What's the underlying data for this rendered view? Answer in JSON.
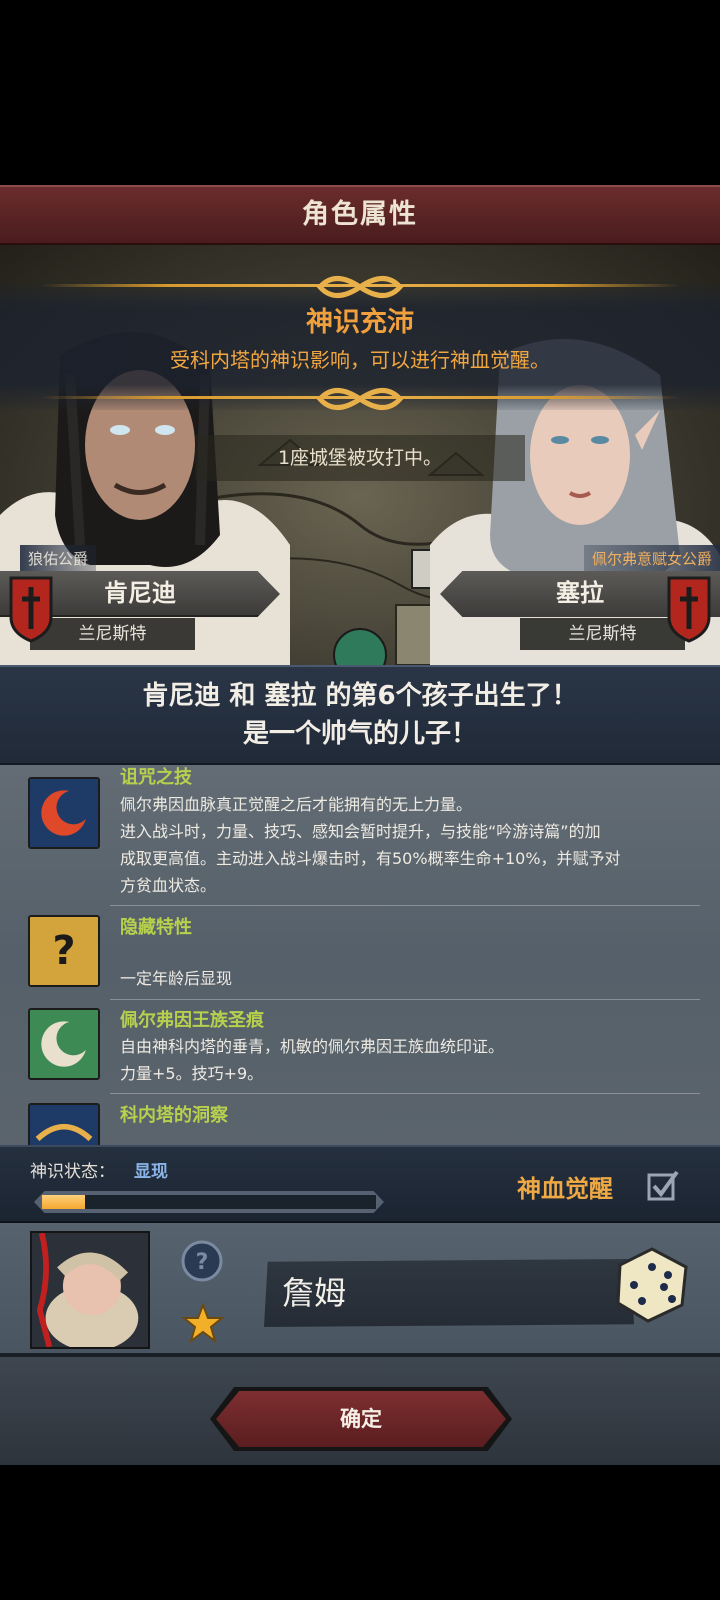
{
  "header": {
    "title": "角色属性"
  },
  "notice": {
    "title": "神识充沛",
    "text": "受科内塔的神识影响，可以进行神血觉醒。"
  },
  "map_status": {
    "text": "1座城堡被攻打中。"
  },
  "father": {
    "title": "狼佑公爵",
    "name": "肯尼迪",
    "house": "兰尼斯特"
  },
  "mother": {
    "title": "佩尔弗意赋女公爵",
    "name": "塞拉",
    "house": "兰尼斯特"
  },
  "announcement": {
    "line1": "肯尼迪 和 塞拉 的第6个孩子出生了！",
    "line2": "是一个帅气的儿子！"
  },
  "traits": [
    {
      "name": "诅咒之技",
      "icon": "red-crescent-icon",
      "lines": [
        "佩尔弗因血脉真正觉醒之后才能拥有的无上力量。",
        "进入战斗时，力量、技巧、感知会暂时提升，与技能“吟游诗篇”的加",
        "成取更高值。主动进入战斗爆击时，有50%概率生命+10%，并赋予对",
        "方贫血状态。"
      ]
    },
    {
      "name": "隐藏特性",
      "icon": "question-mark-icon",
      "lines": [
        "一定年龄后显现"
      ]
    },
    {
      "name": "佩尔弗因王族圣痕",
      "icon": "green-crescent-icon",
      "lines": [
        "自由神科内塔的垂青，机敏的佩尔弗因王族血统印证。",
        "力量+5。技巧+9。"
      ]
    },
    {
      "name": "科内塔的洞察",
      "icon": "blue-eye-icon",
      "lines": []
    }
  ],
  "divine_status": {
    "label": "神识状态：",
    "value": "显现",
    "progress": 0.13,
    "awaken_label": "神血觉醒",
    "awaken_checked": true
  },
  "child": {
    "name": "詹姆"
  },
  "footer": {
    "confirm_label": "确定"
  },
  "colors": {
    "accent_orange": "#f0a03c",
    "trait_name_green": "#b7d04e",
    "status_value_blue": "#8ab4e8",
    "confirm_red": "#7e2f30"
  }
}
